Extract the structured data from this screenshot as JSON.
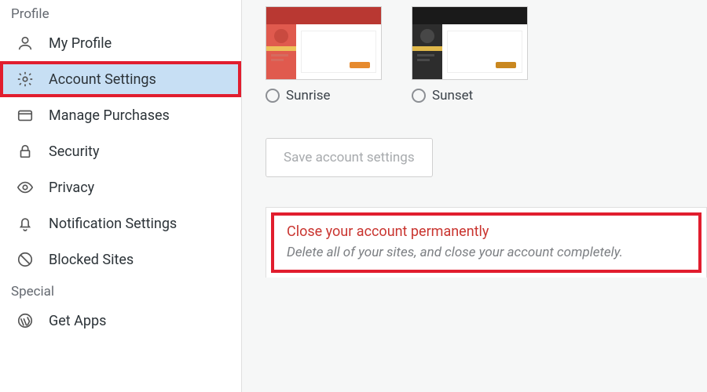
{
  "sidebar": {
    "section_profile": "Profile",
    "section_special": "Special",
    "items": {
      "my_profile": "My Profile",
      "account_settings": "Account Settings",
      "manage_purchases": "Manage Purchases",
      "security": "Security",
      "privacy": "Privacy",
      "notification_settings": "Notification Settings",
      "blocked_sites": "Blocked Sites",
      "get_apps": "Get Apps"
    }
  },
  "themes": {
    "sunrise": "Sunrise",
    "sunset": "Sunset"
  },
  "buttons": {
    "save": "Save account settings"
  },
  "danger": {
    "title": "Close your account permanently",
    "sub": "Delete all of your sites, and close your account completely."
  }
}
